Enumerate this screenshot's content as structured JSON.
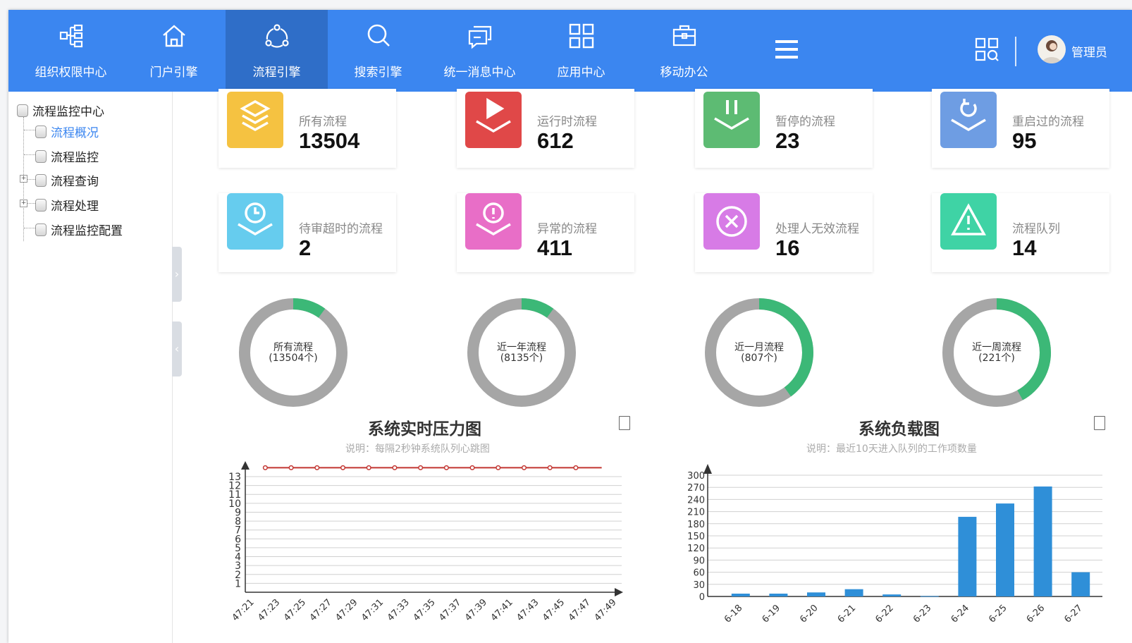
{
  "nav": {
    "items": [
      {
        "label": "组织权限中心",
        "icon": "org-tree-icon"
      },
      {
        "label": "门户引擎",
        "icon": "home-icon"
      },
      {
        "label": "流程引擎",
        "icon": "workflow-icon"
      },
      {
        "label": "搜索引擎",
        "icon": "search-icon"
      },
      {
        "label": "统一消息中心",
        "icon": "message-icon"
      },
      {
        "label": "应用中心",
        "icon": "apps-grid-icon"
      },
      {
        "label": "移动办公",
        "icon": "briefcase-icon"
      }
    ],
    "active_index": 2,
    "user_name": "管理员"
  },
  "sidebar": {
    "root": "流程监控中心",
    "items": [
      "流程概况",
      "流程监控",
      "流程查询",
      "流程处理",
      "流程监控配置"
    ],
    "selected": "流程概况"
  },
  "cards": [
    {
      "title": "所有流程",
      "value": "13504",
      "color": "#f5c241",
      "icon": "layers-icon"
    },
    {
      "title": "运行时流程",
      "value": "612",
      "color": "#e04848",
      "icon": "play-icon"
    },
    {
      "title": "暂停的流程",
      "value": "23",
      "color": "#5dbb73",
      "icon": "pause-icon"
    },
    {
      "title": "重启过的流程",
      "value": "95",
      "color": "#6e9de3",
      "icon": "restart-icon"
    },
    {
      "title": "待审超时的流程",
      "value": "2",
      "color": "#66ccee",
      "icon": "clock-icon"
    },
    {
      "title": "异常的流程",
      "value": "411",
      "color": "#e86ec7",
      "icon": "exclamation-icon"
    },
    {
      "title": "处理人无效流程",
      "value": "16",
      "color": "#d77be6",
      "icon": "x-circle-icon"
    },
    {
      "title": "流程队列",
      "value": "14",
      "color": "#3fd3a5",
      "icon": "warning-icon"
    }
  ],
  "donuts": [
    {
      "label": "所有流程",
      "count": "(13504个)",
      "fraction": 0.1
    },
    {
      "label": "近一年流程",
      "count": "(8135个)",
      "fraction": 0.1
    },
    {
      "label": "近一月流程",
      "count": "(807个)",
      "fraction": 0.4
    },
    {
      "label": "近一周流程",
      "count": "(221个)",
      "fraction": 0.42
    }
  ],
  "colors": {
    "donut_fill": "#3cb877",
    "donut_track": "#a6a6a6",
    "accent": "#3b86f0",
    "nav_active": "#2f6ec8",
    "line": "#c23531",
    "bar": "#2f8fd8"
  },
  "chart_data": [
    {
      "type": "line",
      "title": "系统实时压力图",
      "subtitle": "说明：每隔2秒钟系统队列心跳图",
      "x": [
        "47:21",
        "47:23",
        "47:25",
        "47:27",
        "47:29",
        "47:31",
        "47:33",
        "47:35",
        "47:37",
        "47:39",
        "47:41",
        "47:43",
        "47:45",
        "47:47",
        "47:49"
      ],
      "y_ticks": [
        1,
        2,
        3,
        4,
        5,
        6,
        7,
        8,
        9,
        10,
        11,
        12,
        13
      ],
      "ylim": [
        0,
        13
      ],
      "series": [
        {
          "values": [
            14,
            14,
            14,
            14,
            14,
            14,
            14,
            14,
            14,
            14,
            14,
            14,
            14,
            14
          ]
        }
      ],
      "grid": true
    },
    {
      "type": "bar",
      "title": "系统负载图",
      "subtitle": "说明：最近10天进入队列的工作项数量",
      "categories": [
        "6-18",
        "6-19",
        "6-20",
        "6-21",
        "6-22",
        "6-23",
        "6-24",
        "6-25",
        "6-26",
        "6-27"
      ],
      "values": [
        7,
        7,
        10,
        18,
        5,
        1,
        197,
        230,
        272,
        60
      ],
      "y_ticks": [
        0,
        30,
        60,
        90,
        120,
        150,
        180,
        210,
        240,
        270,
        300
      ],
      "ylim": [
        0,
        300
      ],
      "grid": true
    }
  ]
}
